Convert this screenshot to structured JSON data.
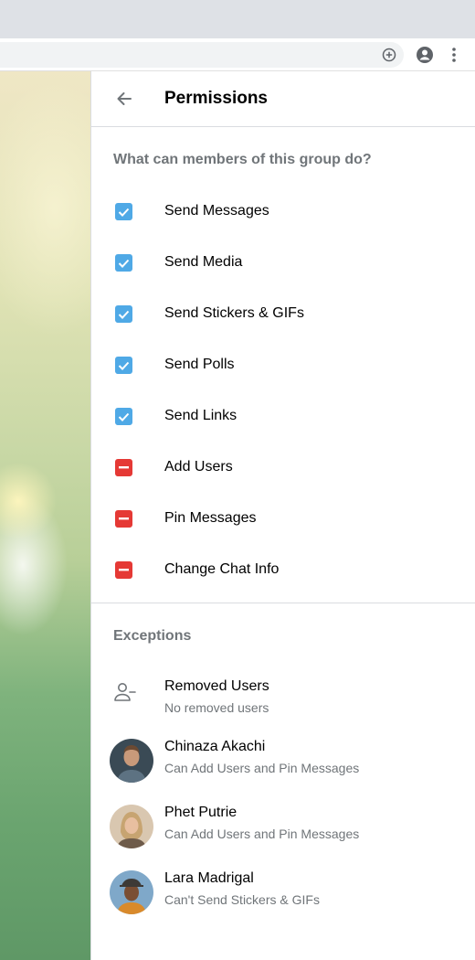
{
  "browser": {
    "icons": [
      "add-circle-icon",
      "account-icon",
      "more-vert-icon"
    ]
  },
  "panel": {
    "title": "Permissions",
    "permissions_heading": "What can members of this group do?",
    "permissions": [
      {
        "label": "Send Messages",
        "enabled": true
      },
      {
        "label": "Send Media",
        "enabled": true
      },
      {
        "label": "Send Stickers & GIFs",
        "enabled": true
      },
      {
        "label": "Send Polls",
        "enabled": true
      },
      {
        "label": "Send Links",
        "enabled": true
      },
      {
        "label": "Add Users",
        "enabled": false
      },
      {
        "label": "Pin Messages",
        "enabled": false
      },
      {
        "label": "Change Chat Info",
        "enabled": false
      }
    ],
    "exceptions_heading": "Exceptions",
    "removed_users": {
      "label": "Removed Users",
      "sub": "No removed users"
    },
    "exceptions": [
      {
        "name": "Chinaza Akachi",
        "sub": "Can Add Users and Pin Messages"
      },
      {
        "name": "Phet Putrie",
        "sub": "Can Add Users and Pin Messages"
      },
      {
        "name": "Lara Madrigal",
        "sub": "Can't Send Stickers & GIFs"
      }
    ]
  },
  "colors": {
    "checkbox_on": "#4fa9e6",
    "checkbox_off": "#e53935",
    "secondary_text": "#707579"
  }
}
